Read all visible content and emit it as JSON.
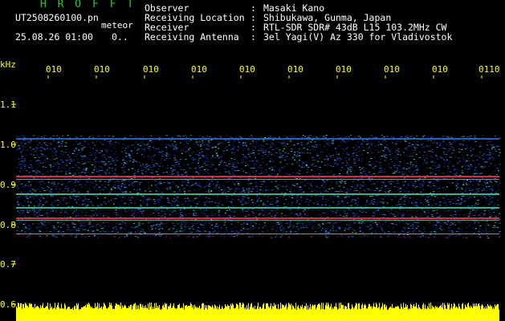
{
  "header": {
    "title": "H R O F F T",
    "filename": "UT2508260100.pn",
    "meteor_label": "meteor",
    "datetime": "25.08.26 01:00",
    "extra": "0..",
    "info": [
      {
        "key": "Observer",
        "value": "Masaki Kano"
      },
      {
        "key": "Receiving Location",
        "value": "Shibukawa, Gunma, Japan"
      },
      {
        "key": "Receiver",
        "value": "RTL-SDR SDR# 43dB L15 103.2MHz CW"
      },
      {
        "key": "Receiving Antenna",
        "value": "3el Yagi(V) Az 330 for Vladivostok"
      }
    ]
  },
  "axes": {
    "y_unit": "kHz",
    "y_ticks": [
      "1.1",
      "1.0",
      "0.9",
      "0.8",
      "0.7",
      "0.6"
    ],
    "x_ticks": [
      "010",
      "010",
      "010",
      "010",
      "010",
      "010",
      "010",
      "010",
      "010",
      "0110"
    ]
  },
  "colors": {
    "text": "#ffffff",
    "title": "#22cc22",
    "axis": "#ffff00",
    "background": "#000000",
    "band_low": "#1a2a8a",
    "band_mid": "#2f6fd0",
    "band_hi": "#40d0a0",
    "line_peak": "#ff3050"
  }
}
